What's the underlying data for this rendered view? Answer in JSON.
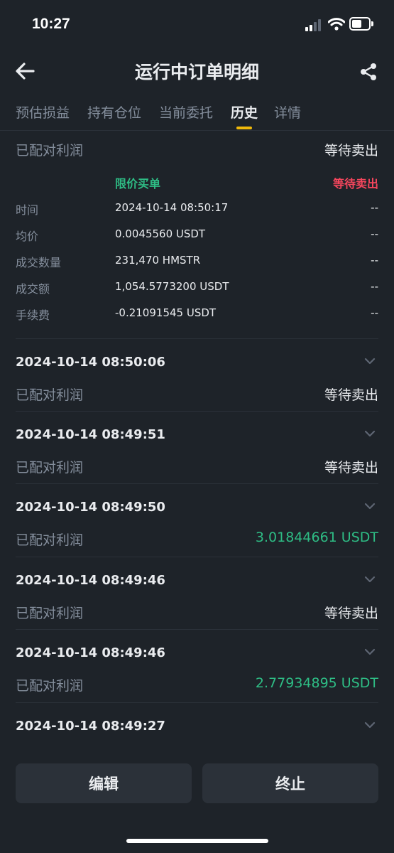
{
  "status_bar": {
    "time": "10:27"
  },
  "header": {
    "title": "运行中订单明细"
  },
  "tabs": [
    {
      "label": "预估损益"
    },
    {
      "label": "持有仓位"
    },
    {
      "label": "当前委托"
    },
    {
      "label": "历史"
    },
    {
      "label": "详情"
    }
  ],
  "active_tab": "历史",
  "expanded_item": {
    "label": "已配对利润",
    "status": "等待卖出",
    "order_type": "限价买单",
    "order_status": "等待卖出",
    "details": [
      {
        "label": "时间",
        "value": "2024-10-14 08:50:17",
        "sell": "--"
      },
      {
        "label": "均价",
        "value": "0.0045560 USDT",
        "sell": "--"
      },
      {
        "label": "成交数量",
        "value": "231,470 HMSTR",
        "sell": "--"
      },
      {
        "label": "成交额",
        "value": "1,054.5773200 USDT",
        "sell": "--"
      },
      {
        "label": "手续费",
        "value": "-0.21091545 USDT",
        "sell": "--"
      }
    ]
  },
  "history": [
    {
      "timestamp": "2024-10-14 08:50:06",
      "label": "已配对利润",
      "value": "等待卖出"
    },
    {
      "timestamp": "2024-10-14 08:49:51",
      "label": "已配对利润",
      "value": "等待卖出"
    },
    {
      "timestamp": "2024-10-14 08:49:50",
      "label": "已配对利润",
      "value": "3.01844661 USDT"
    },
    {
      "timestamp": "2024-10-14 08:49:46",
      "label": "已配对利润",
      "value": "等待卖出"
    },
    {
      "timestamp": "2024-10-14 08:49:46",
      "label": "已配对利润",
      "value": "2.77934895 USDT"
    },
    {
      "timestamp": "2024-10-14 08:49:27"
    }
  ],
  "buttons": {
    "edit": "编辑",
    "stop": "终止"
  },
  "colors": {
    "background": "#1e2329",
    "accent": "#f0b90b",
    "profit": "#2ebd85",
    "sell": "#f6465d",
    "muted": "#848e9c"
  },
  "icons": [
    "back-arrow-icon",
    "share-icon",
    "chevron-down-icon",
    "signal-icon",
    "wifi-icon",
    "battery-icon"
  ]
}
